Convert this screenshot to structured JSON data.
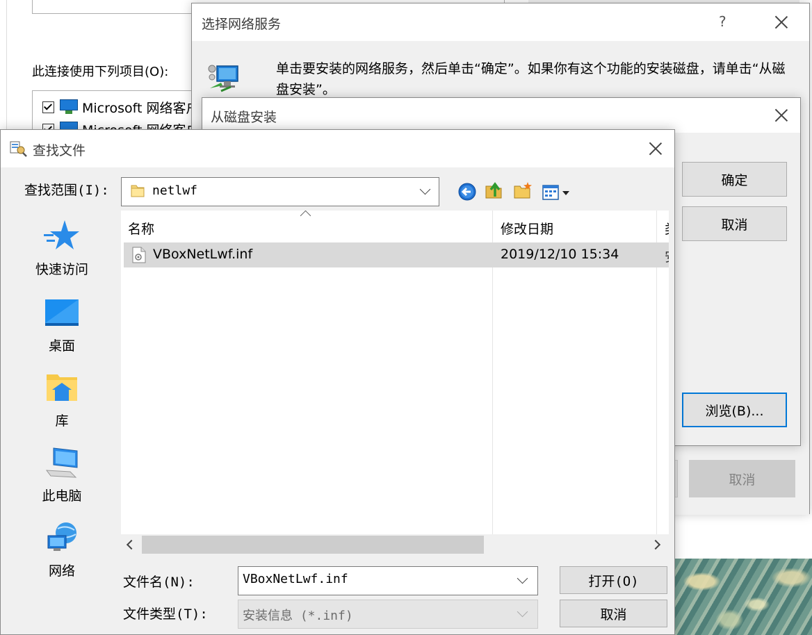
{
  "background_window": {
    "uses_label": "此连接使用下列项目(O):",
    "items": [
      {
        "label": "Microsoft 网络客户端"
      },
      {
        "label": "Microsoft 网络客户端"
      }
    ]
  },
  "select_service_dialog": {
    "title": "选择网络服务",
    "help": "?",
    "instruction": "单击要安装的网络服务，然后单击“确定”。如果你有这个功能的安装磁盘，请单击“从磁盘安装”。",
    "cancel_label": "取消"
  },
  "disk_install_dialog": {
    "title": "从磁盘安装",
    "ok_label": "确定",
    "cancel_label": "取消",
    "browse_label": "浏览(B)..."
  },
  "find_file_dialog": {
    "title": "查找文件",
    "look_in_label": "查找范围(I):",
    "look_in_value": "netlwf",
    "toolbar": [
      "back-icon",
      "up-folder-icon",
      "new-folder-icon",
      "view-menu-icon"
    ],
    "places": [
      {
        "label": "快速访问",
        "icon": "star-icon"
      },
      {
        "label": "桌面",
        "icon": "desktop-icon"
      },
      {
        "label": "库",
        "icon": "library-icon"
      },
      {
        "label": "此电脑",
        "icon": "computer-icon"
      },
      {
        "label": "网络",
        "icon": "network-icon"
      }
    ],
    "columns": {
      "name": "名称",
      "modified": "修改日期",
      "type_partial": "类"
    },
    "files": [
      {
        "name": "VBoxNetLwf.inf",
        "modified": "2019/12/10 15:34",
        "type_partial": "安"
      }
    ],
    "file_name_label": "文件名(N):",
    "file_name_value": "VBoxNetLwf.inf",
    "file_type_label": "文件类型(T):",
    "file_type_value": "安装信息 (*.inf)",
    "open_label": "打开(O)",
    "cancel_label": "取消"
  }
}
